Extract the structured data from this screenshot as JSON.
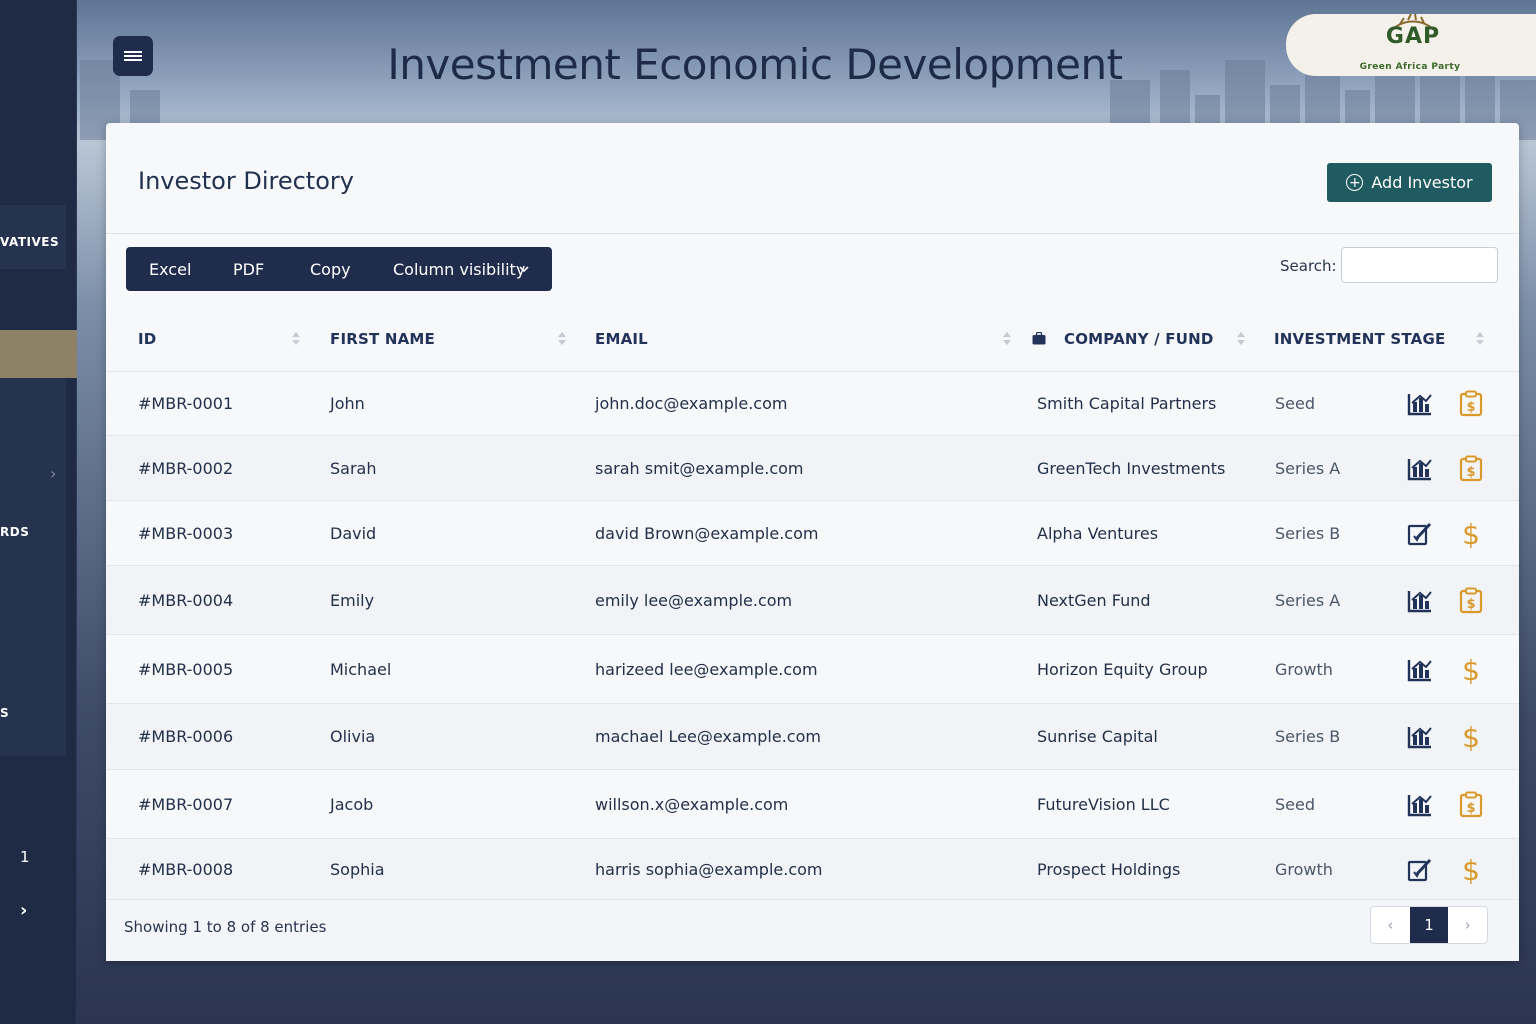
{
  "header": {
    "title": "Investment Economic Development",
    "logo_text": "GAP",
    "logo_sub": "Green Africa Party"
  },
  "sidebar": {
    "items": [
      "VATIVES",
      "RDS",
      "S"
    ],
    "page": "1"
  },
  "card": {
    "title": "Investor Directory",
    "add_label": "Add Investor",
    "toolbar": {
      "excel": "Excel",
      "pdf": "PDF",
      "copy": "Copy",
      "column_visibility": "Column visibility"
    },
    "search_label": "Search:",
    "search_value": ""
  },
  "table": {
    "columns": [
      "ID",
      "FIRST NAME",
      "EMAIL",
      "COMPANY / FUND",
      "INVESTMENT STAGE"
    ],
    "rows": [
      {
        "id": "#MBR-0001",
        "first": "John",
        "email": "john.doc@example.com",
        "company": "Smith Capital Partners",
        "stage": "Seed",
        "icon1": "chart-icon",
        "icon2": "clipboard-dollar-icon"
      },
      {
        "id": "#MBR-0002",
        "first": "Sarah",
        "email": "sarah smit@example.com",
        "company": "GreenTech Investments",
        "stage": "Series A",
        "icon1": "chart-icon",
        "icon2": "clipboard-dollar-icon"
      },
      {
        "id": "#MBR-0003",
        "first": "David",
        "email": "david Brown@example.com",
        "company": "Alpha Ventures",
        "stage": "Series B",
        "icon1": "edit-icon",
        "icon2": "dollar-icon"
      },
      {
        "id": "#MBR-0004",
        "first": "Emily",
        "email": "emily lee@example.com",
        "company": "NextGen Fund",
        "stage": "Series A",
        "icon1": "chart-icon",
        "icon2": "clipboard-dollar-icon"
      },
      {
        "id": "#MBR-0005",
        "first": "Michael",
        "email": "harizeed lee@example.com",
        "company": "Horizon Equity Group",
        "stage": "Growth",
        "icon1": "chart-icon",
        "icon2": "dollar-icon"
      },
      {
        "id": "#MBR-0006",
        "first": "Olivia",
        "email": "machael Lee@example.com",
        "company": "Sunrise Capital",
        "stage": "Series B",
        "icon1": "chart-icon",
        "icon2": "dollar-icon"
      },
      {
        "id": "#MBR-0007",
        "first": "Jacob",
        "email": "willson.x@example.com",
        "company": "FutureVision LLC",
        "stage": "Seed",
        "icon1": "chart-icon",
        "icon2": "clipboard-dollar-icon"
      },
      {
        "id": "#MBR-0008",
        "first": "Sophia",
        "email": "harris sophia@example.com",
        "company": "Prospect Holdings",
        "stage": "Growth",
        "icon1": "edit-icon",
        "icon2": "dollar-icon"
      }
    ]
  },
  "footer": {
    "info": "Showing 1 to 8 of 8 entries",
    "prev": "‹",
    "page": "1",
    "next": "›"
  },
  "colors": {
    "navy": "#1f2c4c",
    "teal": "#1f5b61",
    "gold": "#d99a2b",
    "icon_navy": "#22335a"
  }
}
